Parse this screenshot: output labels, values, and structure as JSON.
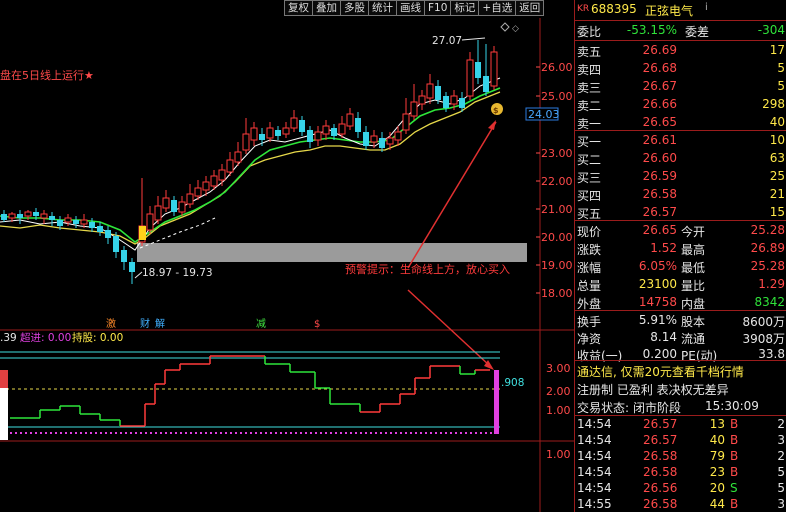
{
  "toolbar": {
    "buttons": [
      "复权",
      "叠加",
      "多股",
      "统计",
      "画线",
      "F10",
      "标记",
      "+自选",
      "返回"
    ]
  },
  "main_chart": {
    "indicator_text": "盘在5日线上运行★",
    "price_axis": [
      "26.00",
      "25.00",
      "24.00",
      "23.00",
      "22.00",
      "21.00",
      "20.00",
      "19.00",
      "18.00"
    ],
    "current_price_tag": "24.03",
    "high_label": "27.07",
    "low_range_label": "18.97 - 19.73",
    "alert_text": "预警提示：生命线上方，放心买入",
    "money_bag_icon": "money-bag-icon"
  },
  "event_marks": [
    "激",
    "财",
    "解",
    "减",
    "$"
  ],
  "sub_chart": {
    "label_a": ".39",
    "label_b": "超进: 0.00",
    "label_c": "持股: 0.00",
    "axis": [
      "3.00",
      "2.00",
      "1.00"
    ],
    "value_tag": ".908",
    "lower_axis": [
      "1.00"
    ]
  },
  "quote": {
    "code_prefix": "KR",
    "code": "688395",
    "name": "正弦电气",
    "info_icon": "i",
    "weibi_label": "委比",
    "weibi_value": "-53.15%",
    "weicha_label": "委差",
    "weicha_value": "-304",
    "asks": [
      {
        "label": "卖五",
        "price": "26.69",
        "vol": "17"
      },
      {
        "label": "卖四",
        "price": "26.68",
        "vol": "5"
      },
      {
        "label": "卖三",
        "price": "26.67",
        "vol": "5"
      },
      {
        "label": "卖二",
        "price": "26.66",
        "vol": "298"
      },
      {
        "label": "卖一",
        "price": "26.65",
        "vol": "40"
      }
    ],
    "bids": [
      {
        "label": "买一",
        "price": "26.61",
        "vol": "10"
      },
      {
        "label": "买二",
        "price": "26.60",
        "vol": "63"
      },
      {
        "label": "买三",
        "price": "26.59",
        "vol": "25"
      },
      {
        "label": "买四",
        "price": "26.58",
        "vol": "21"
      },
      {
        "label": "买五",
        "price": "26.57",
        "vol": "15"
      }
    ],
    "stats": [
      {
        "l1": "现价",
        "v1": "26.65",
        "l2": "今开",
        "v2": "25.28"
      },
      {
        "l1": "涨跌",
        "v1": "1.52",
        "l2": "最高",
        "v2": "26.89"
      },
      {
        "l1": "涨幅",
        "v1": "6.05%",
        "l2": "最低",
        "v2": "25.28"
      },
      {
        "l1": "总量",
        "v1": "23100",
        "l2": "量比",
        "v2": "1.29"
      },
      {
        "l1": "外盘",
        "v1": "14758",
        "l2": "内盘",
        "v2": "8342"
      }
    ],
    "stats2": [
      {
        "l1": "换手",
        "v1": "5.91%",
        "l2": "股本",
        "v2": "8600万"
      },
      {
        "l1": "净资",
        "v1": "8.14",
        "l2": "流通",
        "v2": "3908万"
      },
      {
        "l1": "收益(一)",
        "v1": "0.200",
        "l2": "PE(动)",
        "v2": "33.8"
      }
    ],
    "notice": "通达信, 仅需20元查看千档行情",
    "reg_status": "注册制 已盈利 表决权无差异",
    "trade_status_label": "交易状态:",
    "trade_status_value": "闭市阶段",
    "trade_status_time": "15:30:09",
    "ticks": [
      {
        "time": "14:54",
        "price": "26.57",
        "vol": "13",
        "dir": "B",
        "n": "2"
      },
      {
        "time": "14:54",
        "price": "26.57",
        "vol": "40",
        "dir": "B",
        "n": "3"
      },
      {
        "time": "14:54",
        "price": "26.58",
        "vol": "79",
        "dir": "B",
        "n": "2"
      },
      {
        "time": "14:54",
        "price": "26.58",
        "vol": "23",
        "dir": "B",
        "n": "5"
      },
      {
        "time": "14:54",
        "price": "26.56",
        "vol": "20",
        "dir": "S",
        "n": "5"
      },
      {
        "time": "14:55",
        "price": "26.58",
        "vol": "44",
        "dir": "B",
        "n": "3"
      }
    ]
  },
  "colors": {
    "up": "#ff3b3b",
    "down": "#36d3e8",
    "ma5": "#ffffff",
    "ma10": "#e6d84a",
    "ma20": "#2ee63a",
    "border": "#9b1c1c"
  }
}
